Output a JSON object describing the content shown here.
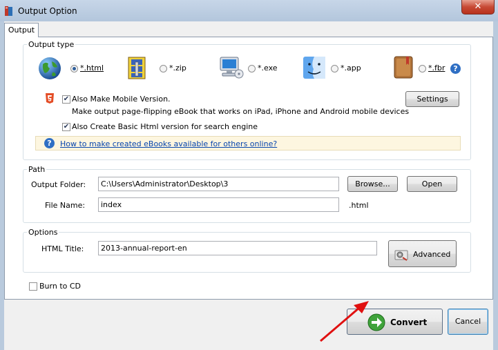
{
  "window": {
    "title": "Output Option",
    "close_glyph": "✕"
  },
  "tabs": [
    {
      "label": "Output"
    }
  ],
  "output_type": {
    "group_label": "Output type",
    "options": [
      {
        "label": "*.html",
        "icon": "globe-icon",
        "selected": true
      },
      {
        "label": "*.zip",
        "icon": "zip-archive-icon",
        "selected": false
      },
      {
        "label": "*.exe",
        "icon": "computer-icon",
        "selected": false
      },
      {
        "label": "*.app",
        "icon": "mac-finder-icon",
        "selected": false
      },
      {
        "label": "*.fbr",
        "icon": "book-icon",
        "selected": false
      }
    ],
    "mobile_label": "Also Make Mobile Version.",
    "mobile_desc": "Make output page-flipping eBook that works on iPad, iPhone and Android mobile devices",
    "basic_html_label": "Also Create Basic Html version for search engine",
    "settings_label": "Settings",
    "help_link": "How to make created eBooks available for others online?"
  },
  "path": {
    "group_label": "Path",
    "output_folder_label": "Output Folder:",
    "output_folder_value": "C:\\Users\\Administrator\\Desktop\\3",
    "browse_label": "Browse...",
    "open_label": "Open",
    "file_name_label": "File Name:",
    "file_name_value": "index",
    "extension": ".html"
  },
  "options": {
    "group_label": "Options",
    "html_title_label": "HTML Title:",
    "html_title_value": "2013-annual-report-en",
    "advanced_label": "Advanced"
  },
  "burn_label": "Burn to CD",
  "footer": {
    "convert_label": "Convert",
    "cancel_label": "Cancel"
  },
  "colors": {
    "accent": "#2f6fc4",
    "arrow": "#e01010",
    "help_bg": "#fdf6e0"
  }
}
